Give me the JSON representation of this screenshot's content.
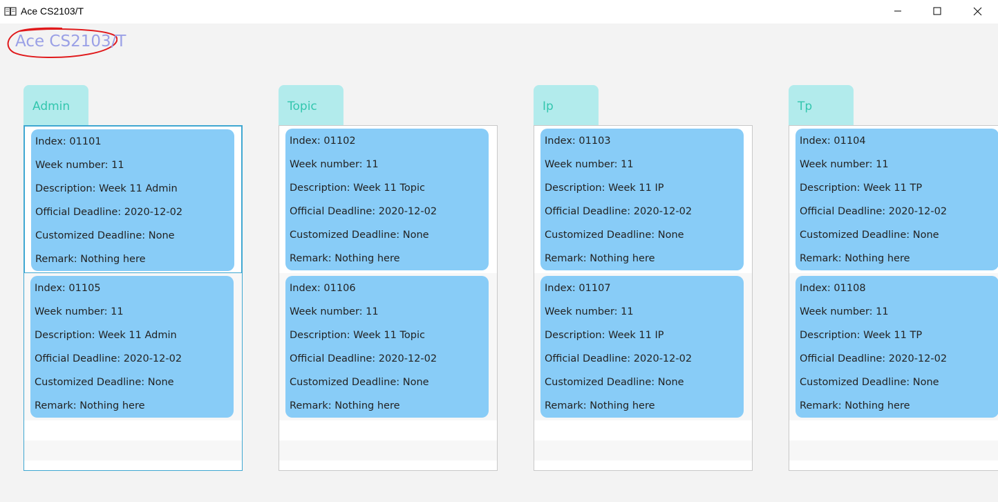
{
  "window": {
    "title": "Ace CS2103/T",
    "controls": [
      "minimize",
      "maximize",
      "close"
    ]
  },
  "app": {
    "header": "Ace CS2103/T"
  },
  "columns": [
    {
      "name": "Admin",
      "tasks": [
        {
          "index": "Index: 01101",
          "week": "Week number: 11",
          "description": "Description: Week 11 Admin",
          "official_deadline": "Official Deadline: 2020-12-02",
          "customized_deadline": "Customized Deadline: None",
          "remark": "Remark: Nothing here"
        },
        {
          "index": "Index: 01105",
          "week": "Week number: 11",
          "description": "Description: Week 11 Admin",
          "official_deadline": "Official Deadline: 2020-12-02",
          "customized_deadline": "Customized Deadline: None",
          "remark": "Remark: Nothing here"
        }
      ]
    },
    {
      "name": "Topic",
      "tasks": [
        {
          "index": "Index: 01102",
          "week": "Week number: 11",
          "description": "Description: Week 11 Topic",
          "official_deadline": "Official Deadline: 2020-12-02",
          "customized_deadline": "Customized Deadline: None",
          "remark": "Remark: Nothing here"
        },
        {
          "index": "Index: 01106",
          "week": "Week number: 11",
          "description": "Description: Week 11 Topic",
          "official_deadline": "Official Deadline: 2020-12-02",
          "customized_deadline": "Customized Deadline: None",
          "remark": "Remark: Nothing here"
        }
      ]
    },
    {
      "name": "Ip",
      "tasks": [
        {
          "index": "Index: 01103",
          "week": "Week number: 11",
          "description": "Description: Week 11 IP",
          "official_deadline": "Official Deadline: 2020-12-02",
          "customized_deadline": "Customized Deadline: None",
          "remark": "Remark: Nothing here"
        },
        {
          "index": "Index: 01107",
          "week": "Week number: 11",
          "description": "Description: Week 11 IP",
          "official_deadline": "Official Deadline: 2020-12-02",
          "customized_deadline": "Customized Deadline: None",
          "remark": "Remark: Nothing here"
        }
      ]
    },
    {
      "name": "Tp",
      "tasks": [
        {
          "index": "Index: 01104",
          "week": "Week number: 11",
          "description": "Description: Week 11 TP",
          "official_deadline": "Official Deadline: 2020-12-02",
          "customized_deadline": "Customized Deadline: None",
          "remark": "Remark: Nothing here"
        },
        {
          "index": "Index: 01108",
          "week": "Week number: 11",
          "description": "Description: Week 11 TP",
          "official_deadline": "Official Deadline: 2020-12-02",
          "customized_deadline": "Customized Deadline: None",
          "remark": "Remark: Nothing here"
        }
      ]
    }
  ],
  "colors": {
    "card": "#88ccf7",
    "column_header": "#b2ebec",
    "column_header_text": "#33c6ae",
    "app_header_text": "#9aa0e6",
    "annotation_circle": "#e0191b",
    "focus_border": "#3ea7d1"
  }
}
